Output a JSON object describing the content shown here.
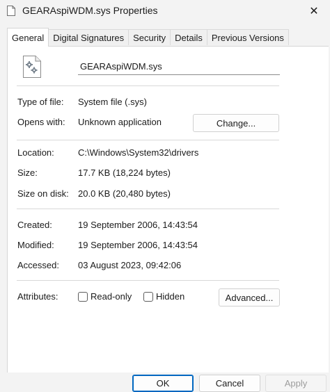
{
  "window": {
    "title": "GEARAspiWDM.sys Properties",
    "close_label": "✕"
  },
  "tabs": [
    {
      "label": "General",
      "active": true
    },
    {
      "label": "Digital Signatures",
      "active": false
    },
    {
      "label": "Security",
      "active": false
    },
    {
      "label": "Details",
      "active": false
    },
    {
      "label": "Previous Versions",
      "active": false
    }
  ],
  "file": {
    "icon": "system-file-gear-icon",
    "name": "GEARAspiWDM.sys"
  },
  "properties": {
    "type_label": "Type of file:",
    "type_value": "System file (.sys)",
    "opens_label": "Opens with:",
    "opens_value": "Unknown application",
    "change_button": "Change...",
    "location_label": "Location:",
    "location_value": "C:\\Windows\\System32\\drivers",
    "size_label": "Size:",
    "size_value": "17.7 KB (18,224 bytes)",
    "size_disk_label": "Size on disk:",
    "size_disk_value": "20.0 KB (20,480 bytes)",
    "created_label": "Created:",
    "created_value": "19 September 2006, 14:43:54",
    "modified_label": "Modified:",
    "modified_value": "19 September 2006, 14:43:54",
    "accessed_label": "Accessed:",
    "accessed_value": "03 August 2023, 09:42:06",
    "attributes_label": "Attributes:",
    "readonly_label": "Read-only",
    "readonly_checked": false,
    "hidden_label": "Hidden",
    "hidden_checked": false,
    "advanced_button": "Advanced..."
  },
  "footer": {
    "ok": "OK",
    "cancel": "Cancel",
    "apply": "Apply"
  },
  "colors": {
    "accent": "#0067c0",
    "disabled_text": "#9c9c9c"
  }
}
